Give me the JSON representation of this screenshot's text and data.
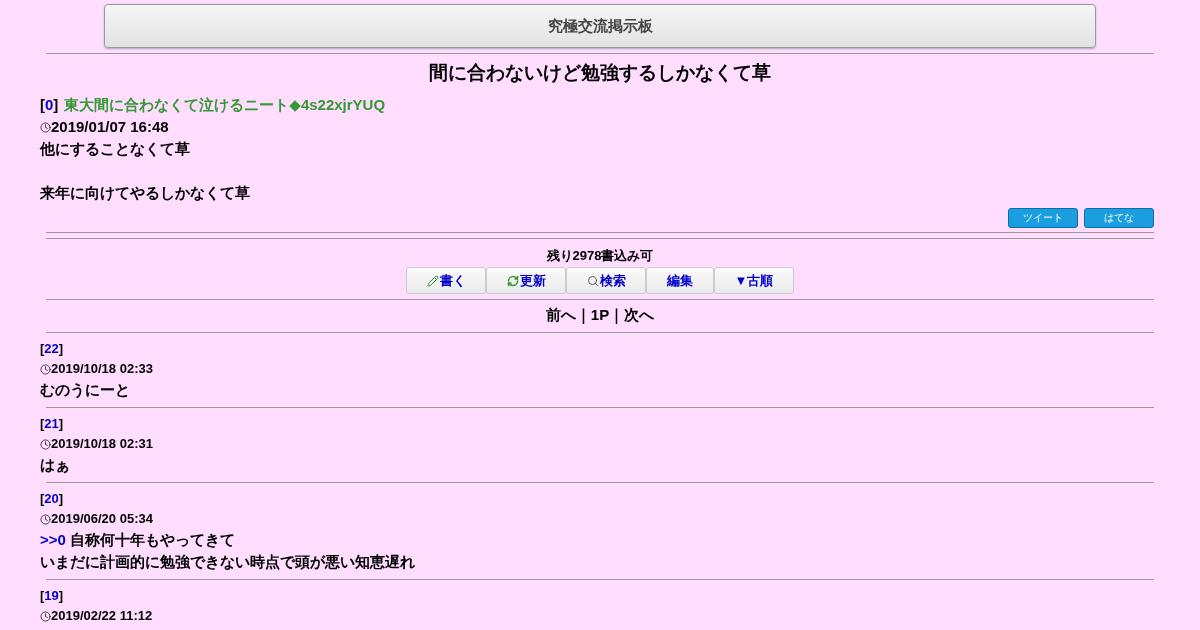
{
  "header": {
    "title": "究極交流掲示板"
  },
  "thread": {
    "title": "間に合わないけど勉強するしかなくて草",
    "op": {
      "open_bracket": "[",
      "number": "0",
      "close_bracket": "]",
      "name": "東大間に合わなくて泣けるニート◆4s22xjrYUQ",
      "date": "2019/01/07 16:48",
      "paragraphs": [
        [
          "他にすることなくて草"
        ],
        [
          "来年に向けてやるしかなくて草"
        ]
      ]
    },
    "share_buttons": [
      "ツイート",
      "はてな"
    ]
  },
  "remaining": "残り2978書込み可",
  "toolbar": [
    {
      "kind": "write",
      "label": "書く"
    },
    {
      "kind": "refresh",
      "label": "更新"
    },
    {
      "kind": "search",
      "label": "検索"
    },
    {
      "kind": "plain",
      "label": "編集"
    },
    {
      "kind": "plain",
      "label": "▼古順"
    }
  ],
  "pager": {
    "prev": "前へ",
    "page": "1P",
    "next": "次へ",
    "separator": "｜"
  },
  "posts": [
    {
      "open_bracket": "[",
      "number": "22",
      "close_bracket": "]",
      "date": "2019/10/18 02:33",
      "lines": [
        {
          "text": "むのうにーと"
        }
      ]
    },
    {
      "open_bracket": "[",
      "number": "21",
      "close_bracket": "]",
      "date": "2019/10/18 02:31",
      "lines": [
        {
          "text": "はぁ"
        }
      ]
    },
    {
      "open_bracket": "[",
      "number": "20",
      "close_bracket": "]",
      "date": "2019/06/20 05:34",
      "lines": [
        {
          "anchor": ">>0",
          "text": "自称何十年もやってきて"
        },
        {
          "text": "いまだに計画的に勉強できない時点で頭が悪い知恵遅れ"
        }
      ]
    },
    {
      "open_bracket": "[",
      "number": "19",
      "close_bracket": "]",
      "date": "2019/02/22 11:12"
    }
  ]
}
